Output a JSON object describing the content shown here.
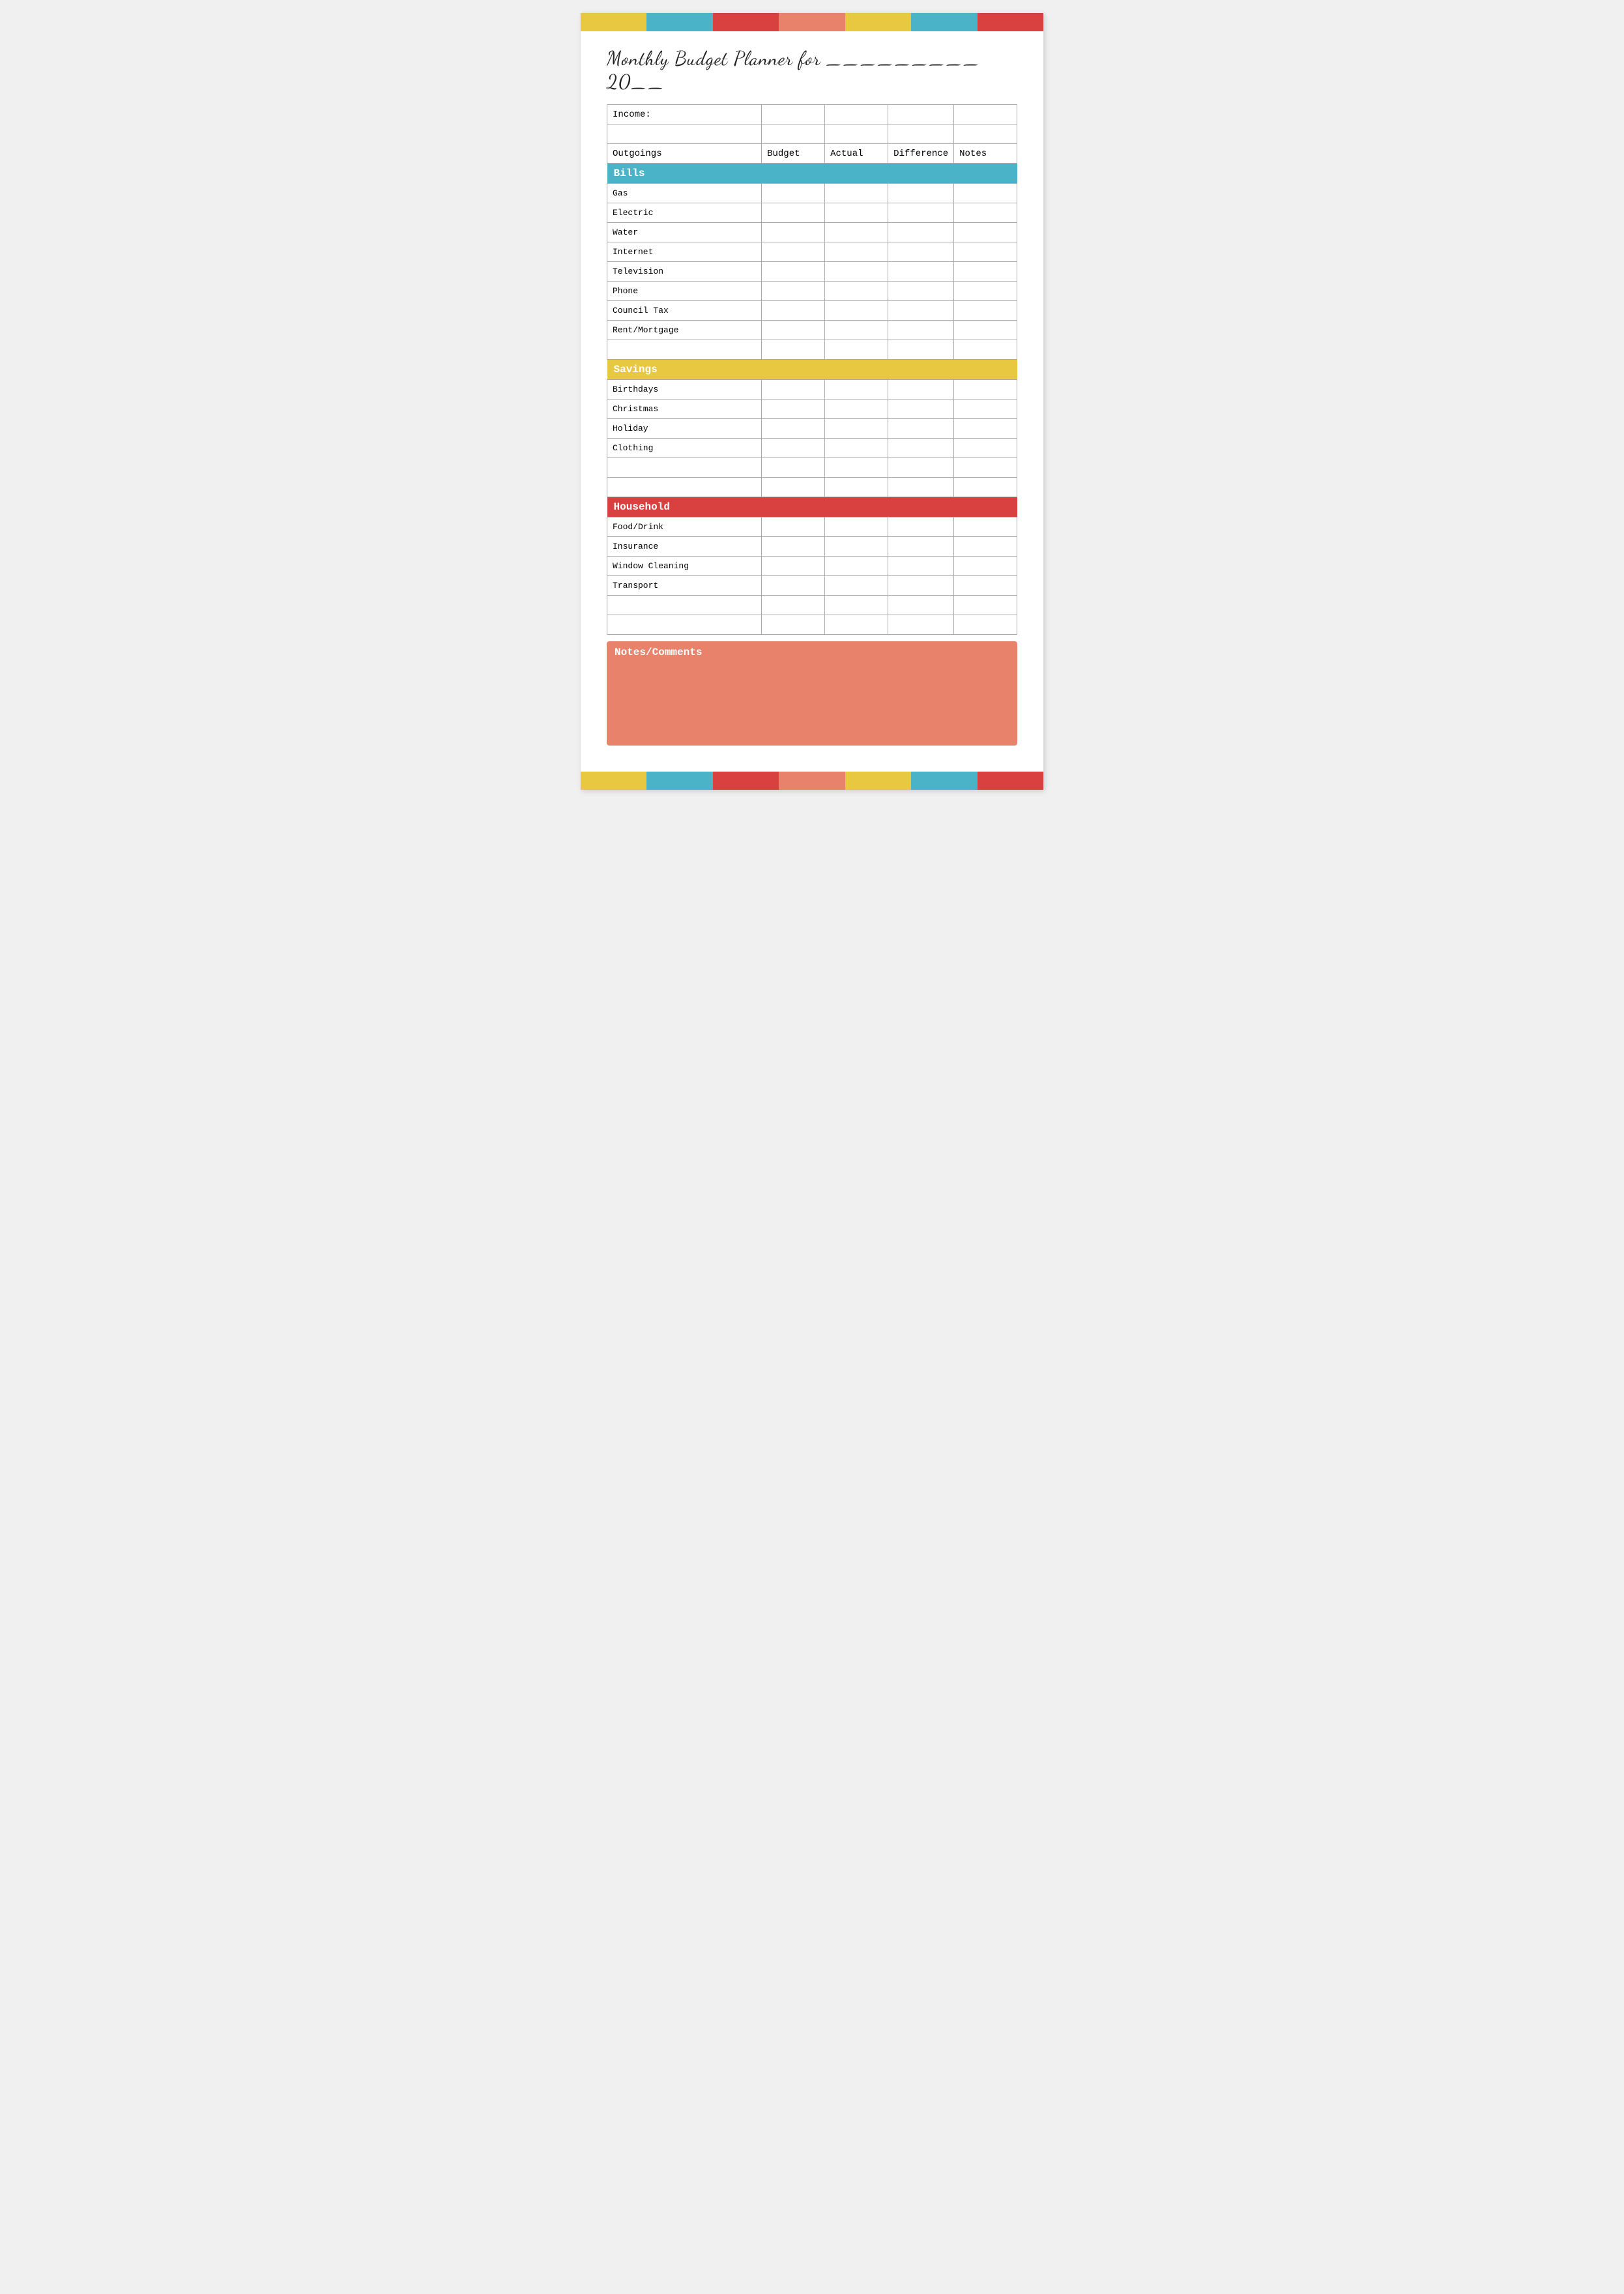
{
  "colorBar": {
    "segments": [
      "yellow",
      "teal",
      "red",
      "salmon",
      "yellow2",
      "teal2",
      "red2"
    ]
  },
  "title": {
    "line1": "Monthly Budget Planner for _________ 20__"
  },
  "table": {
    "incomeLabel": "Income:",
    "columns": {
      "outgoings": "Outgoings",
      "budget": "Budget",
      "actual": "Actual",
      "difference": "Difference",
      "notes": "Notes"
    },
    "categories": [
      {
        "name": "Bills",
        "color": "bills-header",
        "items": [
          "Gas",
          "Electric",
          "Water",
          "Internet",
          "Television",
          "Phone",
          "Council Tax",
          "Rent/Mortgage"
        ],
        "emptyRows": 1
      },
      {
        "name": "Savings",
        "color": "savings-header",
        "items": [
          "Birthdays",
          "Christmas",
          "Holiday",
          "Clothing"
        ],
        "emptyRows": 2
      },
      {
        "name": "Household",
        "color": "household-header",
        "items": [
          "Food/Drink",
          "Insurance",
          "Window Cleaning",
          "Transport"
        ],
        "emptyRows": 2
      }
    ]
  },
  "notes": {
    "label": "Notes/Comments"
  }
}
